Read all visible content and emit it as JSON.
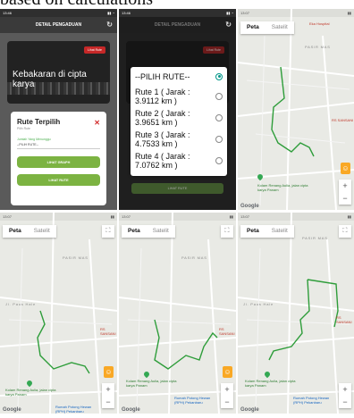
{
  "caption": "based on calculations",
  "screen1": {
    "time": "13:46",
    "header": "DETAIL PENGADUAN",
    "news_title": "Kebakaran di cipta karya",
    "badge": "Lihat Rute",
    "dialog": {
      "title": "Rute Terpilih",
      "subtitle": "Pilih Rute",
      "field_label": "Jumlah Yang Menunggu",
      "field_value": "--PILIH RUTE--",
      "btn_graph": "LIHAT GRAPH",
      "btn_route": "LIHAT RUTE"
    }
  },
  "screen2": {
    "time": "13:46",
    "header": "DETAIL PENGADUAN",
    "badge": "Lihat Rute",
    "options": [
      "--PILIH RUTE--",
      "Rute 1 ( Jarak : 3.9112 km )",
      "Rute 2 ( Jarak : 3.9651 km )",
      "Rute 3 ( Jarak : 4.7533 km )",
      "Rute 4 ( Jarak : 7.0762 km )"
    ],
    "selected_index": 0,
    "dim_button": "LIHAT RUTE"
  },
  "map": {
    "tab_map": "Peta",
    "tab_satellite": "Satelit",
    "fullscreen_icon": "fullscreen-icon",
    "zoom_in": "+",
    "zoom_out": "−",
    "google": "Google",
    "label_eka": "Eka Hospital",
    "label_pasir": "PASIR MAS",
    "label_rs": "RS SANSANI",
    "label_kolam": "Kolam Renang Aulia, jalan cipta karya Panam",
    "label_rumah": "Rumah Potong Hewan (RPH) Pekanbaru",
    "label_road": "Jl. Paus Hale"
  },
  "map_time": "13:07",
  "colors": {
    "route": "#2e9d3a",
    "button": "#7cb342",
    "close": "#d32f2f",
    "radio": "#009688"
  }
}
